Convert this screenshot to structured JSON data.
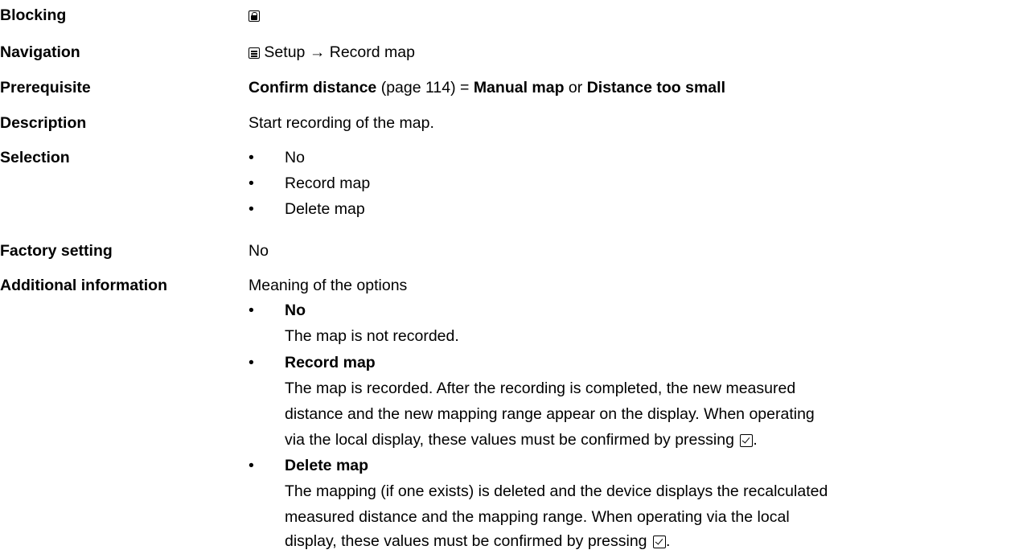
{
  "rows": {
    "blocking": {
      "label": "Blocking",
      "icon": "lock-icon"
    },
    "navigation": {
      "label": "Navigation",
      "icon": "menu-icon",
      "path_start": "Setup",
      "arrow": "→",
      "path_end": "Record map"
    },
    "prerequisite": {
      "label": "Prerequisite",
      "param": "Confirm distance",
      "page_ref": "(page 114)",
      "equals": "=",
      "option1": "Manual map",
      "or": "or",
      "option2": "Distance too small"
    },
    "description": {
      "label": "Description",
      "text": "Start recording of the map."
    },
    "selection": {
      "label": "Selection",
      "options": [
        "No",
        "Record map",
        "Delete map"
      ]
    },
    "factory_setting": {
      "label": "Factory setting",
      "value": "No"
    },
    "additional_information": {
      "label": "Additional information",
      "intro": "Meaning of the options",
      "options": [
        {
          "title": "No",
          "lines": [
            "The map is not recorded."
          ]
        },
        {
          "title": "Record map",
          "lines": [
            "The map is recorded. After the recording is completed, the new measured",
            "distance and the new mapping range appear on the display. When operating",
            "via the local display, these values must be confirmed by pressing"
          ],
          "confirm_icon": "check-icon"
        },
        {
          "title": "Delete map",
          "lines": [
            "The mapping (if one exists) is deleted and the device displays the recalculated",
            "measured distance and the mapping range. When operating via the local",
            "display, these values must be confirmed by pressing"
          ],
          "confirm_icon": "check-icon"
        }
      ]
    }
  },
  "bullet": "•"
}
